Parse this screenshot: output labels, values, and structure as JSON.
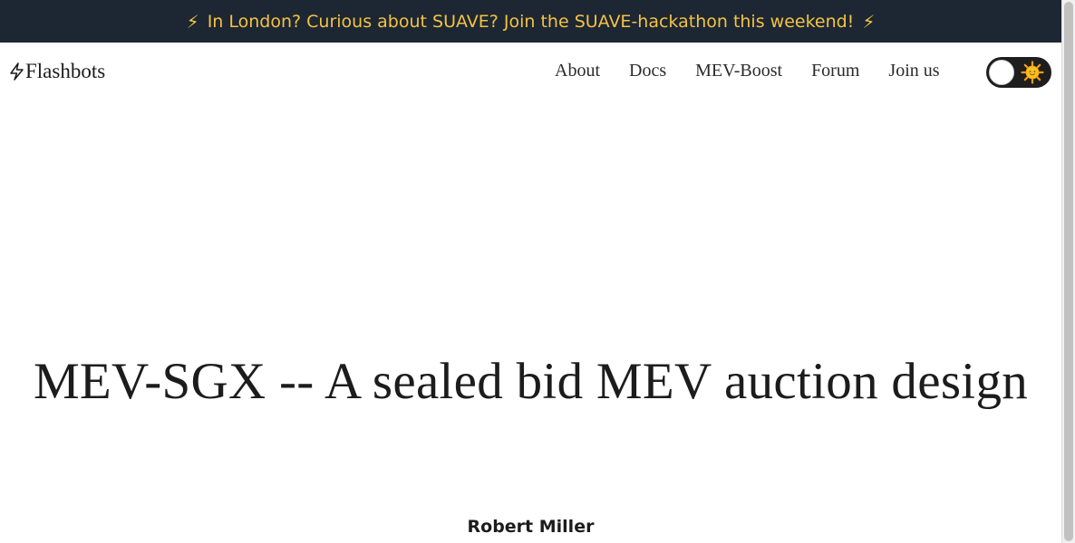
{
  "banner": {
    "icon": "lightning-bolt-icon",
    "glyph": "⚡",
    "text": "In London? Curious about SUAVE? Join the SUAVE-hackathon this weekend!",
    "background": "#1c2733",
    "text_color": "#f5c243"
  },
  "header": {
    "logo_icon": "lightning-bolt-icon",
    "logo_text": "Flashbots",
    "nav": [
      {
        "label": "About"
      },
      {
        "label": "Docs"
      },
      {
        "label": "MEV-Boost"
      },
      {
        "label": "Forum"
      },
      {
        "label": "Join us"
      }
    ],
    "theme_toggle": {
      "icon": "sun-icon",
      "state": "light"
    }
  },
  "article": {
    "title": "MEV-SGX -- A sealed bid MEV auction design",
    "author": "Robert Miller"
  }
}
